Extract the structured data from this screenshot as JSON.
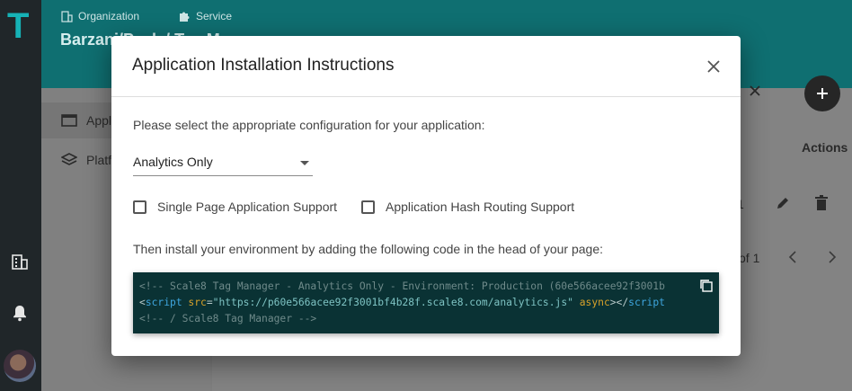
{
  "nav": {
    "logo": "T",
    "icons": [
      "organization-icon",
      "notifications-icon"
    ],
    "avatar": "user-avatar"
  },
  "header": {
    "crumb_org_label": "Organization",
    "crumb_service_label": "Service",
    "title": "Barzani/Peak / Tag Ma"
  },
  "left_panel": {
    "items": [
      {
        "label": "Appli",
        "icon": "app-icon"
      },
      {
        "label": "Platf",
        "icon": "layers-icon"
      }
    ]
  },
  "background": {
    "actions_header": "Actions",
    "row_partial": "1",
    "pagination_text": "of 1"
  },
  "modal": {
    "title": "Application Installation Instructions",
    "prompt": "Please select the appropriate configuration for your application:",
    "select_value": "Analytics Only",
    "checkbox_spa_label": "Single Page Application Support",
    "checkbox_hash_label": "Application Hash Routing Support",
    "install_text": "Then install your environment by adding the following code in the head of your page:",
    "code": {
      "line1": "<!-- Scale8 Tag Manager - Analytics Only - Environment: Production (60e566acee92f3001b",
      "line2_open": "<",
      "line2_tag": "script",
      "line2_attr": " src",
      "line2_eq": "=",
      "line2_str": "\"https://p60e566acee92f3001bf4b28f.scale8.com/analytics.js\"",
      "line2_async": " async",
      "line2_close_open": "></",
      "line2_close_tag": "script",
      "line3": "<!-- / Scale8 Tag Manager -->"
    }
  },
  "colors": {
    "header": "#0f6f71",
    "code_bg": "#0a3234",
    "accent": "#16b2b6"
  }
}
